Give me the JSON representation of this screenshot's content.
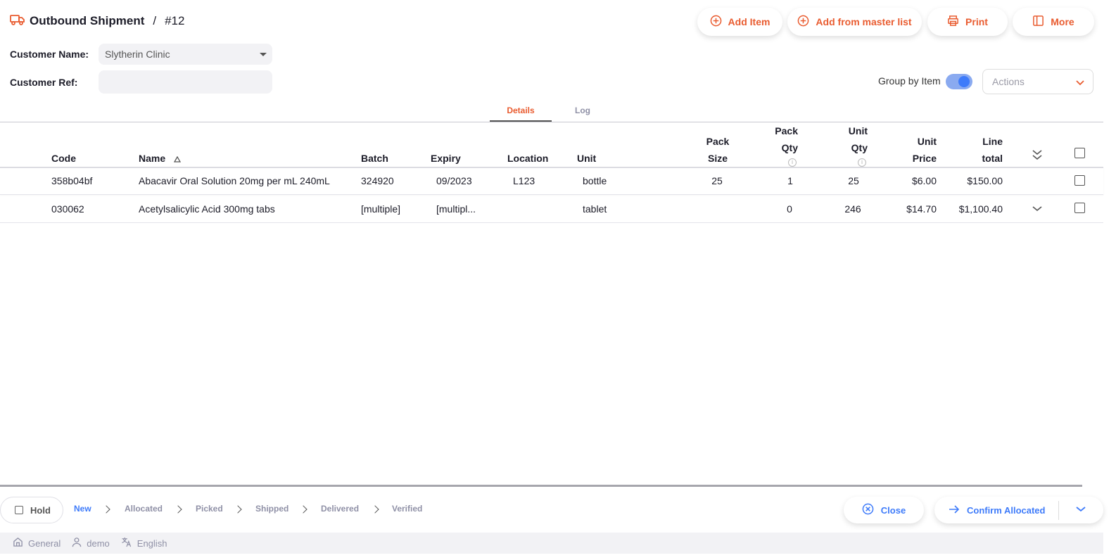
{
  "header": {
    "title": "Outbound Shipment",
    "separator": "/",
    "number": "#12"
  },
  "toolbar": {
    "add_item": "Add Item",
    "add_from_master_list": "Add from master list",
    "print": "Print",
    "more": "More"
  },
  "form": {
    "customer_name_label": "Customer Name:",
    "customer_name_value": "Slytherin Clinic",
    "customer_ref_label": "Customer Ref:",
    "customer_ref_value": ""
  },
  "controls": {
    "group_by_item_label": "Group by Item",
    "group_by_item_on": true,
    "actions_placeholder": "Actions"
  },
  "tabs": [
    {
      "label": "Details",
      "active": true
    },
    {
      "label": "Log",
      "active": false
    }
  ],
  "table": {
    "columns": {
      "code": "Code",
      "name": "Name",
      "batch": "Batch",
      "expiry": "Expiry",
      "location": "Location",
      "unit": "Unit",
      "pack_size_1": "Pack",
      "pack_size_2": "Size",
      "pack_qty_1": "Pack",
      "pack_qty_2": "Qty",
      "unit_qty_1": "Unit",
      "unit_qty_2": "Qty",
      "unit_price_1": "Unit",
      "unit_price_2": "Price",
      "line_total_1": "Line",
      "line_total_2": "total"
    },
    "rows": [
      {
        "code": "358b04bf",
        "name": "Abacavir Oral Solution 20mg per mL 240mL",
        "batch": "324920",
        "expiry": "09/2023",
        "location": "L123",
        "unit": "bottle",
        "pack_size": "25",
        "pack_qty": "1",
        "unit_qty": "25",
        "unit_price": "$6.00",
        "line_total": "$150.00"
      },
      {
        "code": "030062",
        "name": "Acetylsalicylic Acid 300mg tabs",
        "batch": "[multiple]",
        "expiry": "[multipl...",
        "location": "",
        "unit": "tablet",
        "pack_size": "",
        "pack_qty": "0",
        "unit_qty": "246",
        "unit_price": "$14.70",
        "line_total": "$1,100.40"
      }
    ]
  },
  "footer": {
    "hold_label": "Hold",
    "steps": [
      "New",
      "Allocated",
      "Picked",
      "Shipped",
      "Delivered",
      "Verified"
    ],
    "close_label": "Close",
    "confirm_label": "Confirm Allocated"
  },
  "statusbar": {
    "store": "General",
    "user": "demo",
    "language": "English"
  },
  "colors": {
    "accent": "#e95c30",
    "primary": "#3e7bfa"
  }
}
